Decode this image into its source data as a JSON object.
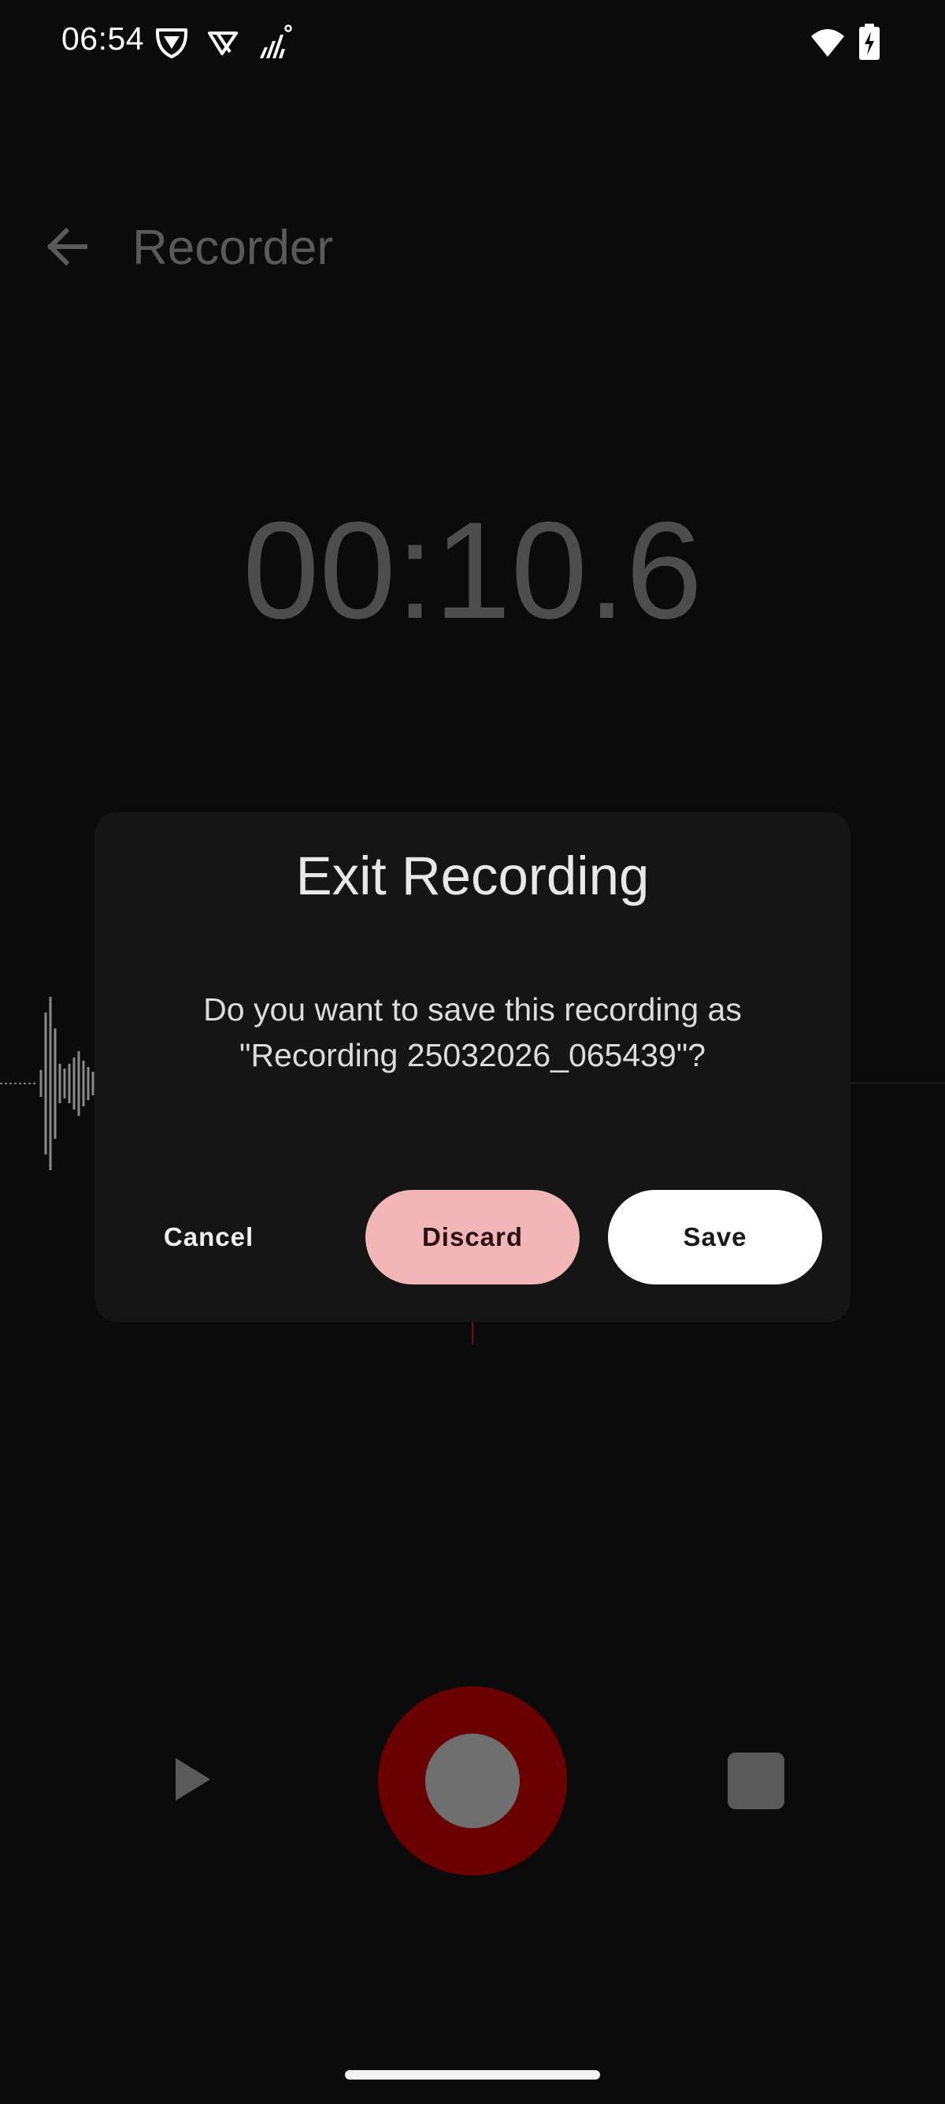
{
  "status_bar": {
    "time": "06:54",
    "icons": [
      "vpn-shield-icon",
      "app-notification-icon",
      "signal-icon",
      "wifi-icon",
      "battery-charging-icon"
    ]
  },
  "app_bar": {
    "back_icon": "arrow-left-icon",
    "title": "Recorder"
  },
  "timer": {
    "elapsed": "00:10.6"
  },
  "dialog": {
    "title": "Exit Recording",
    "message": "Do you want to save this recording as \"Recording 25032026_065439\"?",
    "buttons": {
      "cancel": "Cancel",
      "discard": "Discard",
      "save": "Save"
    }
  },
  "controls": {
    "play_icon": "play-icon",
    "record_icon": "record-icon",
    "stop_icon": "stop-icon"
  },
  "colors": {
    "background": "#0b0b0b",
    "dialog_background": "#151515",
    "discard_button": "#f1b6b5",
    "save_button": "#ffffff",
    "record_ring": "#6a0000",
    "timer_text": "#4d4d4d"
  }
}
